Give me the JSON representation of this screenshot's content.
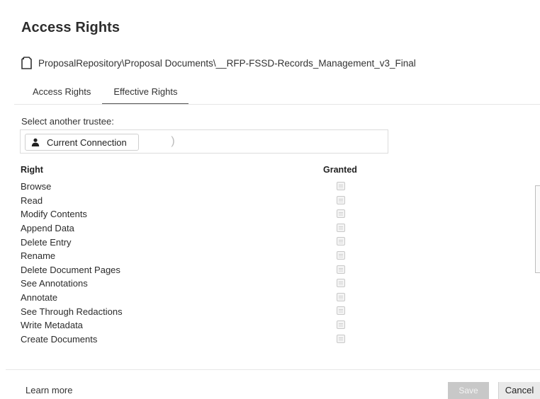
{
  "dialog": {
    "title": "Access Rights",
    "path": "ProposalRepository\\Proposal Documents\\__RFP-FSSD-Records_Management_v3_Final",
    "path_icon": "document-icon"
  },
  "tabs": [
    {
      "label": "Access Rights",
      "active": false
    },
    {
      "label": "Effective Rights",
      "active": true
    }
  ],
  "trustee": {
    "label": "Select another trustee:",
    "chip_label": "Current Connection",
    "chip_icon": "person-icon"
  },
  "table": {
    "columns": {
      "right": "Right",
      "granted": "Granted"
    },
    "rows": [
      {
        "name": "Browse"
      },
      {
        "name": "Read"
      },
      {
        "name": "Modify Contents"
      },
      {
        "name": "Append Data"
      },
      {
        "name": "Delete Entry"
      },
      {
        "name": "Rename"
      },
      {
        "name": "Delete Document Pages"
      },
      {
        "name": "See Annotations"
      },
      {
        "name": "Annotate"
      },
      {
        "name": "See Through Redactions"
      },
      {
        "name": "Write Metadata"
      },
      {
        "name": "Create Documents"
      }
    ]
  },
  "footer": {
    "learn_more": "Learn more",
    "save_label": "Save",
    "cancel_label": "Cancel"
  }
}
